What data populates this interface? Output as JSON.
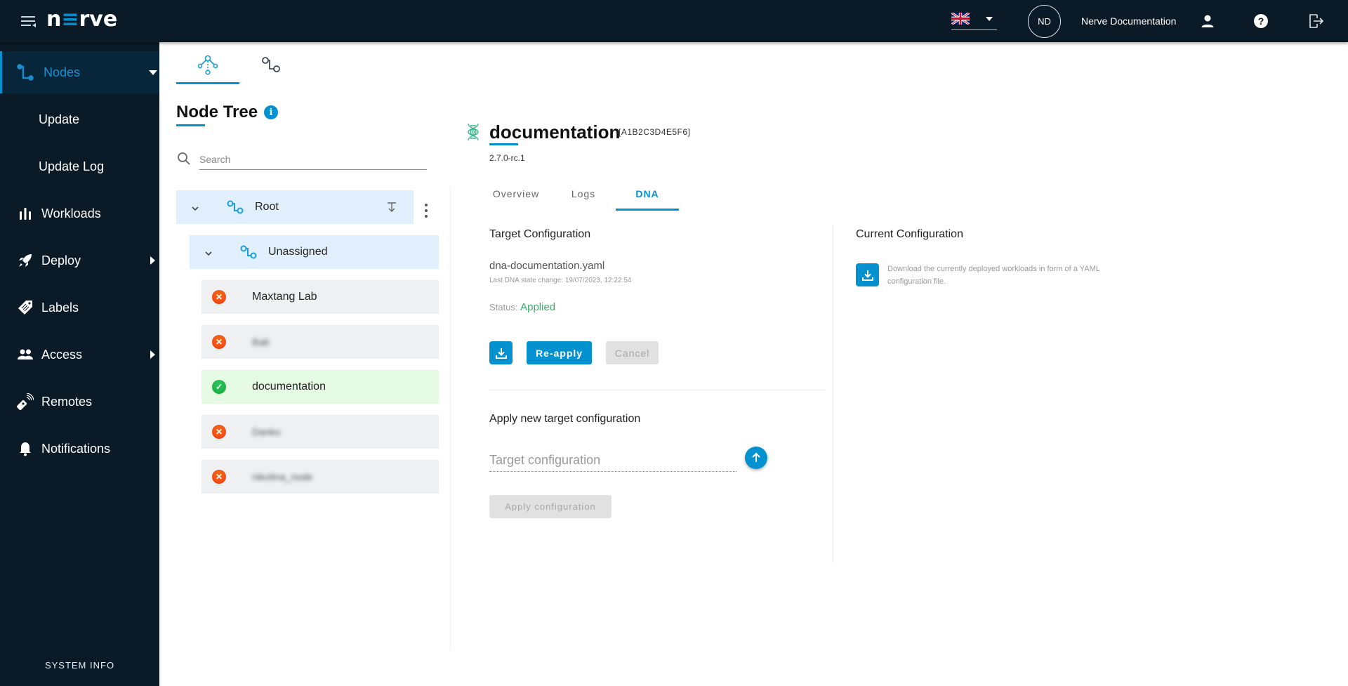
{
  "app": {
    "logo_prefix": "n",
    "logo_accent": "≡",
    "logo_suffix": "rve",
    "brand_color": "#0391d0"
  },
  "topbar": {
    "language": "en-GB",
    "language_icon": "uk-flag-icon",
    "avatar_initials": "ND",
    "username": "Nerve Documentation",
    "icons": [
      "menu-toggle-icon",
      "user-icon",
      "help-icon",
      "logout-icon"
    ]
  },
  "sidebar": {
    "items": [
      {
        "label": "Nodes",
        "icon": "nodes-icon",
        "active": true,
        "expand": "down"
      },
      {
        "label": "Update",
        "icon": "",
        "sub": true
      },
      {
        "label": "Update Log",
        "icon": "",
        "sub": true
      },
      {
        "label": "Workloads",
        "icon": "workloads-icon"
      },
      {
        "label": "Deploy",
        "icon": "rocket-icon",
        "expand": "right"
      },
      {
        "label": "Labels",
        "icon": "tag-icon"
      },
      {
        "label": "Access",
        "icon": "users-icon",
        "expand": "right"
      },
      {
        "label": "Remotes",
        "icon": "remote-icon"
      },
      {
        "label": "Notifications",
        "icon": "bell-icon"
      }
    ],
    "footer": "SYSTEM INFO"
  },
  "tree_panel": {
    "view_tabs": [
      {
        "name": "tree-view",
        "icon": "hierarchy-icon",
        "active": true
      },
      {
        "name": "node-view",
        "icon": "node-connection-icon",
        "active": false
      }
    ],
    "title": "Node Tree",
    "search_placeholder": "Search",
    "tree": [
      {
        "label": "Root",
        "type": "group",
        "level": 0
      },
      {
        "label": "Unassigned",
        "type": "group",
        "level": 1
      },
      {
        "label": "Maxtang Lab",
        "type": "node",
        "status": "offline",
        "blurred": false
      },
      {
        "label": "Bab",
        "type": "node",
        "status": "offline",
        "blurred": true
      },
      {
        "label": "documentation",
        "type": "node",
        "status": "online",
        "blurred": false
      },
      {
        "label": "Danko",
        "type": "node",
        "status": "offline",
        "blurred": true
      },
      {
        "label": "nikolina_node",
        "type": "node",
        "status": "offline",
        "blurred": true
      }
    ]
  },
  "detail": {
    "icon": "dna-icon",
    "node_name": "documentation",
    "serial": "[A1B2C3D4E5F6]",
    "version": "2.7.0-rc.1",
    "tabs": [
      {
        "label": "Overview",
        "active": false
      },
      {
        "label": "Logs",
        "active": false
      },
      {
        "label": "DNA",
        "active": true
      }
    ],
    "target": {
      "title": "Target Configuration",
      "filename": "dna-documentation.yaml",
      "last_change": "Last DNA state change: 19/07/2023, 12:22:54",
      "status_label": "Status:",
      "status_value": "Applied",
      "status_color": "#3aaa6a",
      "reapply_label": "Re-apply",
      "cancel_label": "Cancel"
    },
    "apply_new": {
      "title": "Apply new target configuration",
      "input_placeholder": "Target configuration",
      "input_value": "",
      "apply_label": "Apply configuration"
    },
    "current": {
      "title": "Current Configuration",
      "description": "Download the currently deployed workloads in form of a YAML configuration file."
    }
  }
}
